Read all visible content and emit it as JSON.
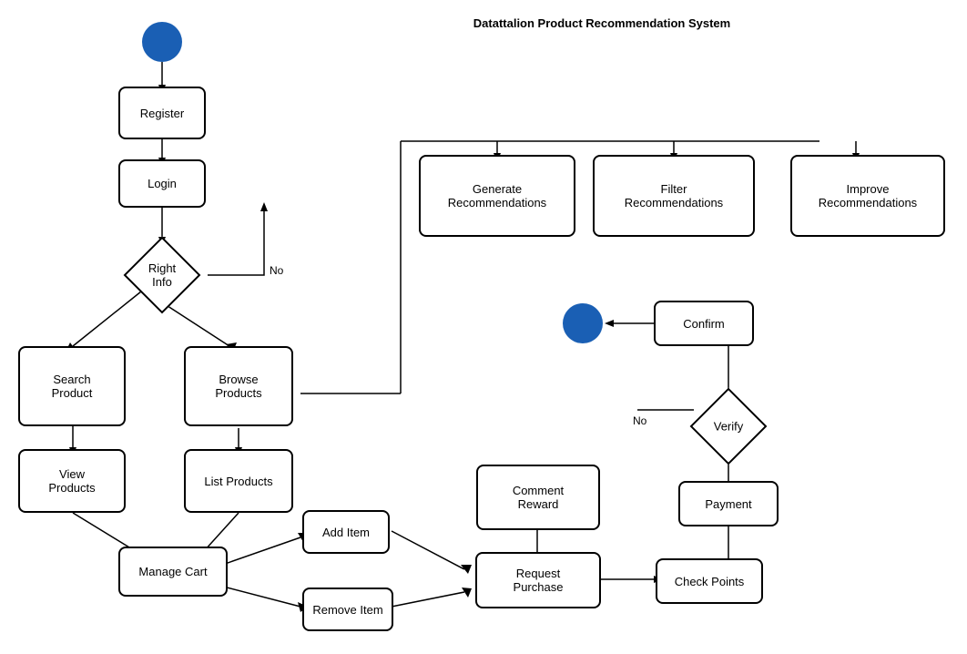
{
  "title": "Datattalion Product Recommendation System",
  "nodes": {
    "start_circle": {
      "label": ""
    },
    "register": {
      "label": "Register"
    },
    "login": {
      "label": "Login"
    },
    "right_info": {
      "label": "Right\nInfo"
    },
    "search_product": {
      "label": "Search\nProduct"
    },
    "browse_products": {
      "label": "Browse\nProducts"
    },
    "view_products": {
      "label": "View\nProducts"
    },
    "list_products": {
      "label": "List Products"
    },
    "manage_cart": {
      "label": "Manage Cart"
    },
    "add_item": {
      "label": "Add Item"
    },
    "remove_item": {
      "label": "Remove Item"
    },
    "generate_recommendations": {
      "label": "Generate\nRecommendations"
    },
    "filter_recommendations": {
      "label": "Filter\nRecommendations"
    },
    "improve_recommendations": {
      "label": "Improve\nRecommendations"
    },
    "confirm": {
      "label": "Confirm"
    },
    "end_circle": {
      "label": ""
    },
    "verify": {
      "label": "Verify"
    },
    "comment_reward": {
      "label": "Comment\nReward"
    },
    "request_purchase": {
      "label": "Request\nPurchase"
    },
    "check_points": {
      "label": "Check Points"
    },
    "payment": {
      "label": "Payment"
    }
  },
  "labels": {
    "no1": "No",
    "no2": "No"
  }
}
